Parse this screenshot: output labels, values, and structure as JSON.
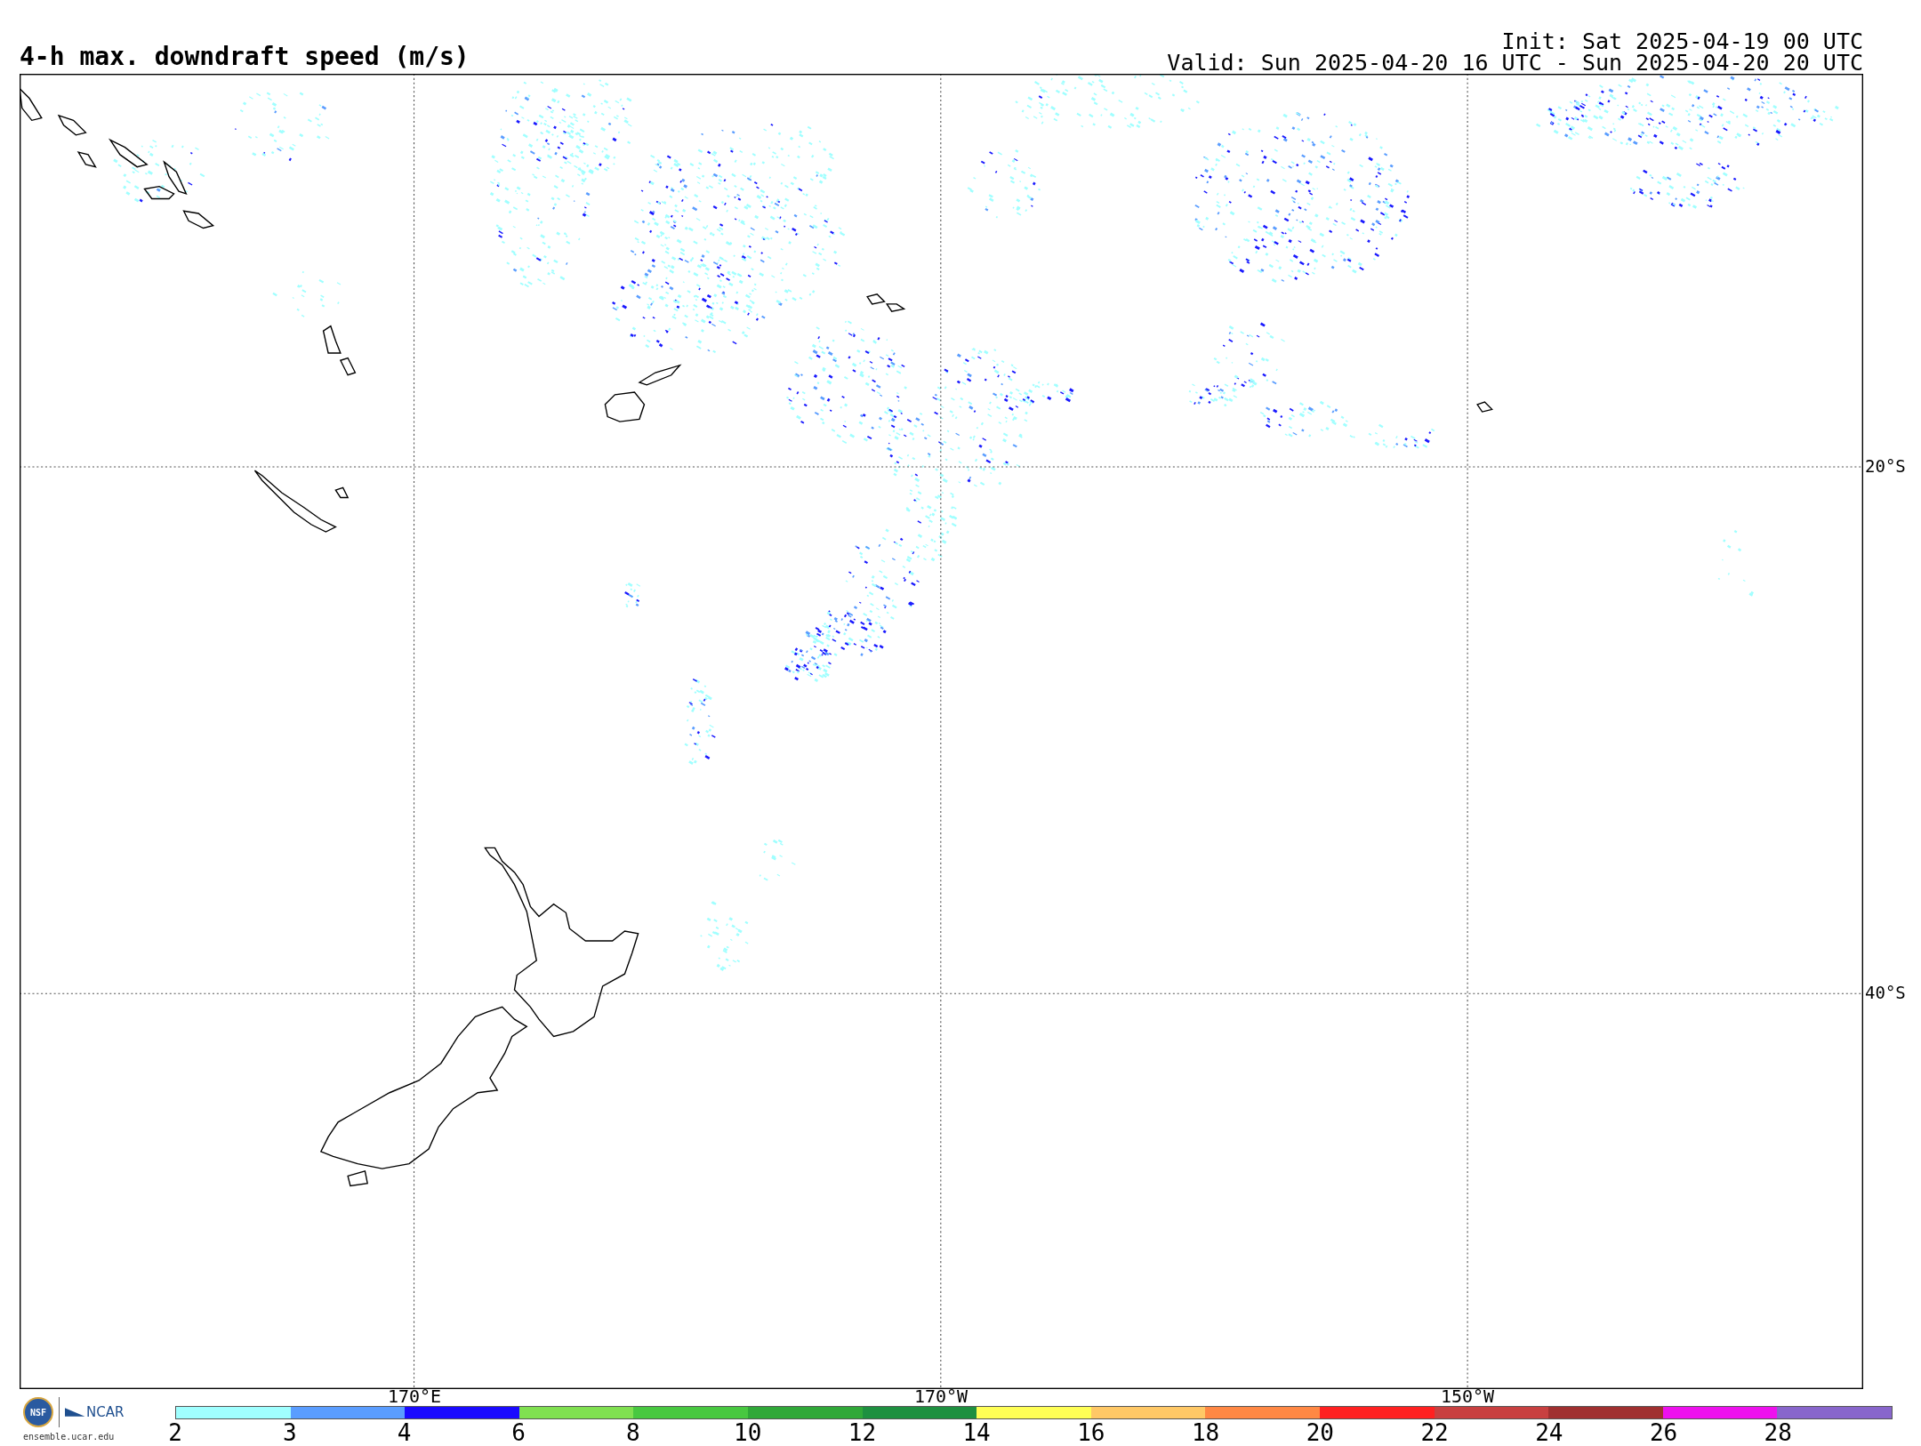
{
  "title": "4-h max. downdraft speed (m/s)",
  "init": "Init: Sat 2025-04-19 00 UTC",
  "valid": "Valid: Sun 2025-04-20 16 UTC - Sun 2025-04-20 20 UTC",
  "lat_labels": [
    "20°S",
    "40°S"
  ],
  "lon_labels": [
    "170°E",
    "170°W",
    "150°W"
  ],
  "logo": {
    "org_1": "NSF",
    "org_2": "NCAR",
    "url": "ensemble.ucar.edu"
  },
  "colorbar": [
    {
      "label": "2",
      "color": "#a0ffff"
    },
    {
      "label": "3",
      "color": "#5a9dff"
    },
    {
      "label": "4",
      "color": "#1a0aff"
    },
    {
      "label": "6",
      "color": "#80e050"
    },
    {
      "label": "8",
      "color": "#48c840"
    },
    {
      "label": "10",
      "color": "#30a838"
    },
    {
      "label": "12",
      "color": "#1e9040"
    },
    {
      "label": "14",
      "color": "#ffff55"
    },
    {
      "label": "16",
      "color": "#ffc866"
    },
    {
      "label": "18",
      "color": "#ff8844"
    },
    {
      "label": "20",
      "color": "#ff2020"
    },
    {
      "label": "22",
      "color": "#c84040"
    },
    {
      "label": "24",
      "color": "#a03030"
    },
    {
      "label": "26",
      "color": "#ee11ee"
    },
    {
      "label": "28",
      "color": "#8866cc"
    }
  ]
}
